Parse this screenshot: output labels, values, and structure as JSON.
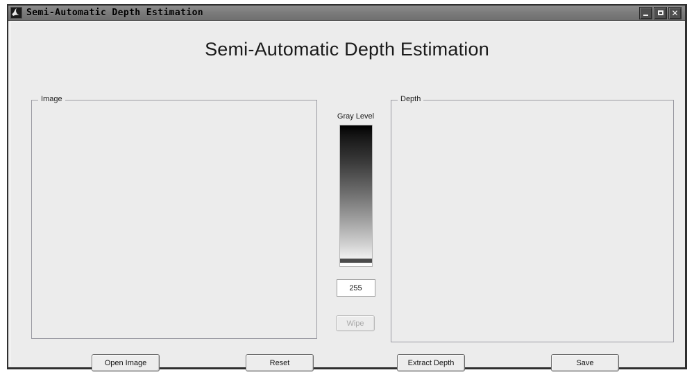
{
  "window": {
    "titlebar": {
      "title": "Semi-Automatic Depth Estimation",
      "icon": "matlab-membrane-icon",
      "controls": {
        "minimize": "minimize-icon",
        "maximize": "maximize-icon",
        "close": "close-icon"
      }
    }
  },
  "main": {
    "heading": "Semi-Automatic Depth Estimation",
    "panels": {
      "image": {
        "label": "Image"
      },
      "depth": {
        "label": "Depth"
      }
    },
    "gray_level": {
      "label": "Gray Level",
      "slider": {
        "orientation": "vertical",
        "gradient_top_color": "#000000",
        "gradient_bottom_color": "#ffffff",
        "min": 0,
        "max": 255,
        "value": 255
      },
      "value_field": "255",
      "wipe_button": {
        "label": "Wipe",
        "enabled": false
      }
    },
    "buttons": {
      "open_image": "Open Image",
      "reset": "Reset",
      "extract_depth": "Extract Depth",
      "save": "Save"
    }
  },
  "theme": {
    "window_background": "#ececec",
    "titlebar_color": "#7c7c7c",
    "border_color": "#2f2f2f",
    "group_border": "#9a9aa2"
  }
}
